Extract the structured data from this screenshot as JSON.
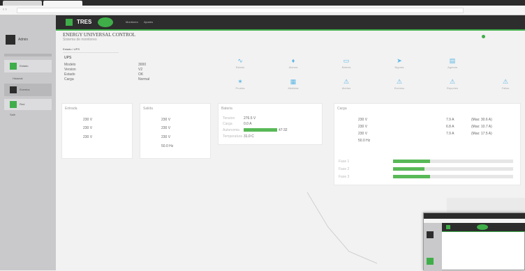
{
  "header": {
    "title": "ENERGY UNIVERSAL CONTROL",
    "subtitle": "Sistema de monitoreo",
    "breadcrumb": "Estado / UPS"
  },
  "nav": {
    "logo": "TRES",
    "items": [
      "Monitoreo",
      "Ajustes"
    ]
  },
  "left_panel": {
    "user": "Admin",
    "items": [
      "Estado",
      "Historial",
      "Eventos",
      "Red",
      "Salir"
    ]
  },
  "ups": {
    "label": "UPS",
    "fields": [
      {
        "k": "Modelo",
        "v": "3000"
      },
      {
        "k": "Version",
        "v": "V2"
      },
      {
        "k": "Estado",
        "v": "OK"
      },
      {
        "k": "Carga",
        "v": "Normal"
      }
    ]
  },
  "actions": [
    {
      "icon": "pulse",
      "label": "Estado"
    },
    {
      "icon": "mic",
      "label": "Alarma"
    },
    {
      "icon": "battery",
      "label": "Bateria"
    },
    {
      "icon": "arrow",
      "label": "Bypass"
    },
    {
      "icon": "calendar",
      "label": "Agenda"
    },
    {
      "icon": "bolt",
      "label": "Prueba"
    },
    {
      "icon": "grid",
      "label": "Medidas"
    },
    {
      "icon": "warning",
      "label": "Alertas"
    },
    {
      "icon": "warning",
      "label": "Eventos"
    },
    {
      "icon": "warning",
      "label": "Reportes"
    },
    {
      "icon": "warning",
      "label": "Fallas"
    }
  ],
  "input": {
    "label": "Entrada",
    "rows": [
      "230 V",
      "230 V",
      "230 V"
    ]
  },
  "output": {
    "label": "Salida",
    "rows": [
      "230 V",
      "230 V",
      "230 V",
      "50.0 Hz"
    ]
  },
  "battery": {
    "label": "Bateria",
    "rows": [
      {
        "k": "Tension",
        "v": "276.5 V"
      },
      {
        "k": "Carga",
        "v": "0.0 A"
      },
      {
        "k": "Autonomia",
        "v": "47:32",
        "bar": 100
      },
      {
        "k": "Temperatura",
        "v": "31.0 C"
      }
    ]
  },
  "load": {
    "label": "Carga",
    "rows": [
      {
        "v": "230 V",
        "a": "7.9 A",
        "p": "(Max: 30.6 A)"
      },
      {
        "v": "230 V",
        "a": "6.8 A",
        "p": "(Max: 10.7 A)"
      },
      {
        "v": "230 V",
        "a": "7.9 A",
        "p": "(Max: 17.5 A)"
      },
      {
        "v": "50.0 Hz"
      }
    ],
    "bars": [
      {
        "label": "Fase 1",
        "pct": 31
      },
      {
        "label": "Fase 2",
        "pct": 26
      },
      {
        "label": "Fase 3",
        "pct": 31
      }
    ]
  }
}
